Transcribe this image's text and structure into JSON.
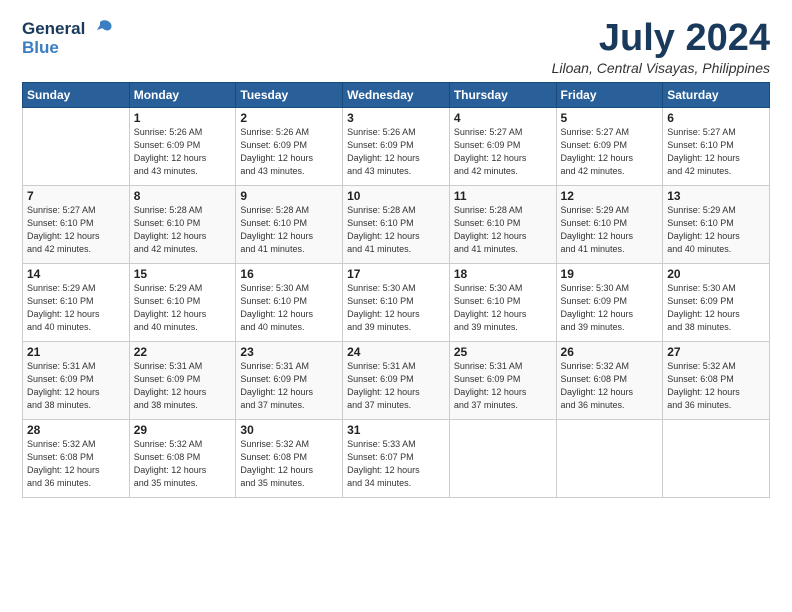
{
  "header": {
    "logo_line1": "General",
    "logo_line2": "Blue",
    "month": "July 2024",
    "location": "Liloan, Central Visayas, Philippines"
  },
  "days_of_week": [
    "Sunday",
    "Monday",
    "Tuesday",
    "Wednesday",
    "Thursday",
    "Friday",
    "Saturday"
  ],
  "weeks": [
    [
      {
        "day": "",
        "info": ""
      },
      {
        "day": "1",
        "info": "Sunrise: 5:26 AM\nSunset: 6:09 PM\nDaylight: 12 hours\nand 43 minutes."
      },
      {
        "day": "2",
        "info": "Sunrise: 5:26 AM\nSunset: 6:09 PM\nDaylight: 12 hours\nand 43 minutes."
      },
      {
        "day": "3",
        "info": "Sunrise: 5:26 AM\nSunset: 6:09 PM\nDaylight: 12 hours\nand 43 minutes."
      },
      {
        "day": "4",
        "info": "Sunrise: 5:27 AM\nSunset: 6:09 PM\nDaylight: 12 hours\nand 42 minutes."
      },
      {
        "day": "5",
        "info": "Sunrise: 5:27 AM\nSunset: 6:09 PM\nDaylight: 12 hours\nand 42 minutes."
      },
      {
        "day": "6",
        "info": "Sunrise: 5:27 AM\nSunset: 6:10 PM\nDaylight: 12 hours\nand 42 minutes."
      }
    ],
    [
      {
        "day": "7",
        "info": "Sunrise: 5:27 AM\nSunset: 6:10 PM\nDaylight: 12 hours\nand 42 minutes."
      },
      {
        "day": "8",
        "info": "Sunrise: 5:28 AM\nSunset: 6:10 PM\nDaylight: 12 hours\nand 42 minutes."
      },
      {
        "day": "9",
        "info": "Sunrise: 5:28 AM\nSunset: 6:10 PM\nDaylight: 12 hours\nand 41 minutes."
      },
      {
        "day": "10",
        "info": "Sunrise: 5:28 AM\nSunset: 6:10 PM\nDaylight: 12 hours\nand 41 minutes."
      },
      {
        "day": "11",
        "info": "Sunrise: 5:28 AM\nSunset: 6:10 PM\nDaylight: 12 hours\nand 41 minutes."
      },
      {
        "day": "12",
        "info": "Sunrise: 5:29 AM\nSunset: 6:10 PM\nDaylight: 12 hours\nand 41 minutes."
      },
      {
        "day": "13",
        "info": "Sunrise: 5:29 AM\nSunset: 6:10 PM\nDaylight: 12 hours\nand 40 minutes."
      }
    ],
    [
      {
        "day": "14",
        "info": "Sunrise: 5:29 AM\nSunset: 6:10 PM\nDaylight: 12 hours\nand 40 minutes."
      },
      {
        "day": "15",
        "info": "Sunrise: 5:29 AM\nSunset: 6:10 PM\nDaylight: 12 hours\nand 40 minutes."
      },
      {
        "day": "16",
        "info": "Sunrise: 5:30 AM\nSunset: 6:10 PM\nDaylight: 12 hours\nand 40 minutes."
      },
      {
        "day": "17",
        "info": "Sunrise: 5:30 AM\nSunset: 6:10 PM\nDaylight: 12 hours\nand 39 minutes."
      },
      {
        "day": "18",
        "info": "Sunrise: 5:30 AM\nSunset: 6:10 PM\nDaylight: 12 hours\nand 39 minutes."
      },
      {
        "day": "19",
        "info": "Sunrise: 5:30 AM\nSunset: 6:09 PM\nDaylight: 12 hours\nand 39 minutes."
      },
      {
        "day": "20",
        "info": "Sunrise: 5:30 AM\nSunset: 6:09 PM\nDaylight: 12 hours\nand 38 minutes."
      }
    ],
    [
      {
        "day": "21",
        "info": "Sunrise: 5:31 AM\nSunset: 6:09 PM\nDaylight: 12 hours\nand 38 minutes."
      },
      {
        "day": "22",
        "info": "Sunrise: 5:31 AM\nSunset: 6:09 PM\nDaylight: 12 hours\nand 38 minutes."
      },
      {
        "day": "23",
        "info": "Sunrise: 5:31 AM\nSunset: 6:09 PM\nDaylight: 12 hours\nand 37 minutes."
      },
      {
        "day": "24",
        "info": "Sunrise: 5:31 AM\nSunset: 6:09 PM\nDaylight: 12 hours\nand 37 minutes."
      },
      {
        "day": "25",
        "info": "Sunrise: 5:31 AM\nSunset: 6:09 PM\nDaylight: 12 hours\nand 37 minutes."
      },
      {
        "day": "26",
        "info": "Sunrise: 5:32 AM\nSunset: 6:08 PM\nDaylight: 12 hours\nand 36 minutes."
      },
      {
        "day": "27",
        "info": "Sunrise: 5:32 AM\nSunset: 6:08 PM\nDaylight: 12 hours\nand 36 minutes."
      }
    ],
    [
      {
        "day": "28",
        "info": "Sunrise: 5:32 AM\nSunset: 6:08 PM\nDaylight: 12 hours\nand 36 minutes."
      },
      {
        "day": "29",
        "info": "Sunrise: 5:32 AM\nSunset: 6:08 PM\nDaylight: 12 hours\nand 35 minutes."
      },
      {
        "day": "30",
        "info": "Sunrise: 5:32 AM\nSunset: 6:08 PM\nDaylight: 12 hours\nand 35 minutes."
      },
      {
        "day": "31",
        "info": "Sunrise: 5:33 AM\nSunset: 6:07 PM\nDaylight: 12 hours\nand 34 minutes."
      },
      {
        "day": "",
        "info": ""
      },
      {
        "day": "",
        "info": ""
      },
      {
        "day": "",
        "info": ""
      }
    ]
  ]
}
